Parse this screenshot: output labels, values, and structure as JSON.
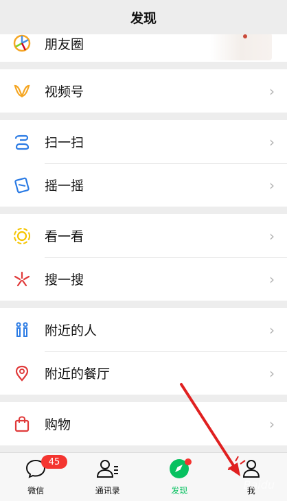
{
  "header": {
    "title": "发现"
  },
  "groups": [
    [
      {
        "label": "朋友圈",
        "icon": "moments-icon"
      }
    ],
    [
      {
        "label": "视频号",
        "icon": "channels-icon"
      }
    ],
    [
      {
        "label": "扫一扫",
        "icon": "scan-icon"
      },
      {
        "label": "摇一摇",
        "icon": "shake-icon"
      }
    ],
    [
      {
        "label": "看一看",
        "icon": "top-stories-icon"
      },
      {
        "label": "搜一搜",
        "icon": "search-icon"
      }
    ],
    [
      {
        "label": "附近的人",
        "icon": "people-nearby-icon"
      },
      {
        "label": "附近的餐厅",
        "icon": "location-pin-icon"
      }
    ],
    [
      {
        "label": "购物",
        "icon": "shopping-bag-icon"
      }
    ]
  ],
  "tabs": [
    {
      "label": "微信",
      "icon": "chat-bubble-icon",
      "badge": "45"
    },
    {
      "label": "通讯录",
      "icon": "contacts-icon"
    },
    {
      "label": "发现",
      "icon": "compass-icon",
      "active": true
    },
    {
      "label": "我",
      "icon": "person-icon"
    }
  ],
  "colors": {
    "accent": "#07c160",
    "badge": "#f43530",
    "annotation_arrow": "#e02020"
  },
  "watermark": "Baidu"
}
